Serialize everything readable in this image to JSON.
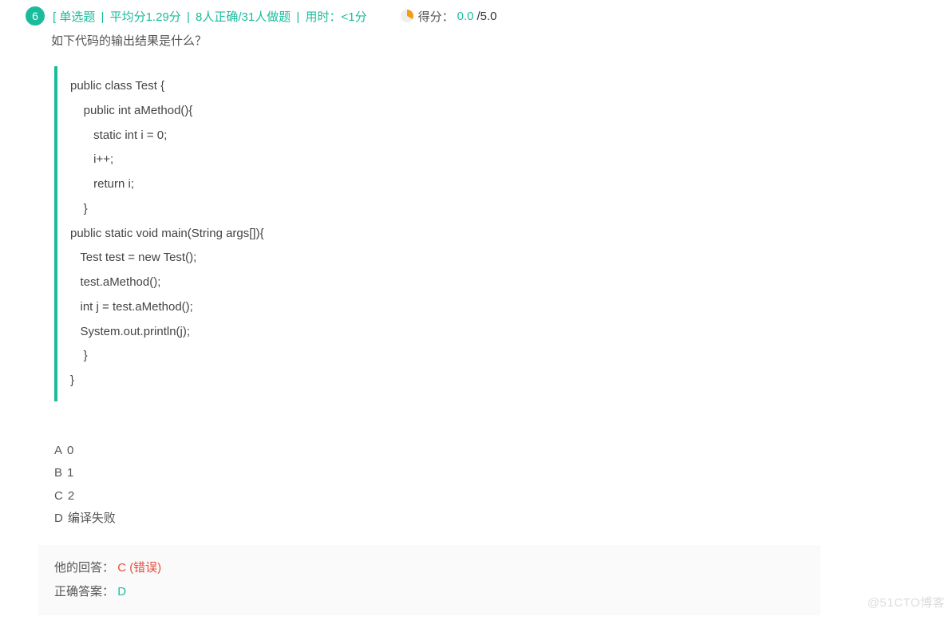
{
  "question": {
    "number": "6",
    "meta": {
      "open_bracket": "[",
      "type": " 单选题 ",
      "avg": " 平均分1.29分 ",
      "stats": " 8人正确/31人做题 ",
      "time": " 用时：<1分",
      "sep": " | "
    },
    "score": {
      "label": "得分：",
      "got": "0.0",
      "slash": " / ",
      "total": "5.0"
    },
    "text": "如下代码的输出结果是什么？",
    "code": {
      "l1": "public class Test {",
      "l2": "    public int aMethod(){",
      "l3": "       static int i = 0;",
      "l4": "       i++;",
      "l5": "       return i;",
      "l6": "    }",
      "l7": "public static void main(String args[]){",
      "l8": "   Test test = new Test();",
      "l9": "   test.aMethod();",
      "l10": "   int j = test.aMethod();",
      "l11": "   System.out.println(j);",
      "l12": "    }",
      "l13": "}"
    },
    "options": {
      "a_label": "A",
      "a_text": "0",
      "b_label": "B",
      "b_text": "1",
      "c_label": "C",
      "c_text": "2",
      "d_label": "D",
      "d_text": "编译失败"
    },
    "answers": {
      "his_label": "他的回答：",
      "his_value": "C (错误)",
      "correct_label": "正确答案：",
      "correct_value": "D"
    }
  },
  "watermark": "@51CTO博客"
}
